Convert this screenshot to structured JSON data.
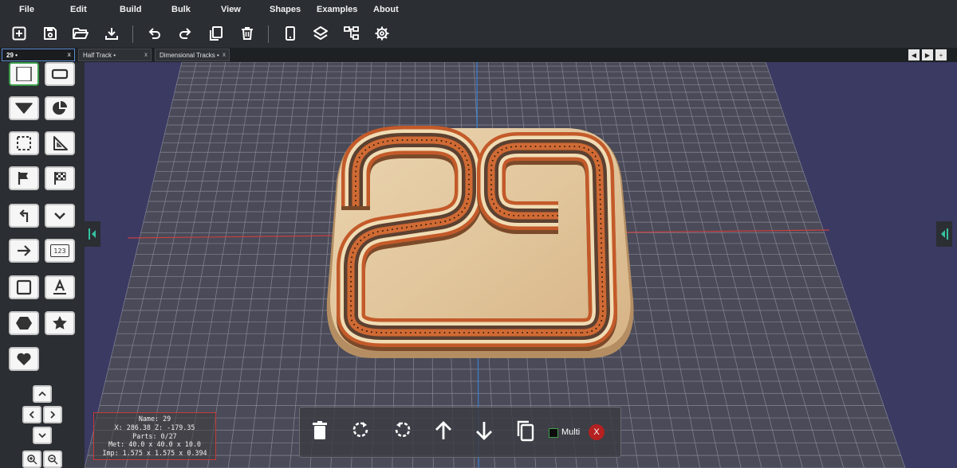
{
  "menu": {
    "items": [
      {
        "label": "File"
      },
      {
        "label": "Edit"
      },
      {
        "label": "Build"
      },
      {
        "label": "Bulk"
      },
      {
        "label": "View"
      },
      {
        "label": "Shapes"
      },
      {
        "label": "Examples"
      },
      {
        "label": "About"
      }
    ]
  },
  "toolbar": {
    "buttons": [
      {
        "icon": "new-file-icon"
      },
      {
        "icon": "save-icon"
      },
      {
        "icon": "open-folder-icon"
      },
      {
        "icon": "download-icon"
      },
      {
        "icon": "undo-icon"
      },
      {
        "icon": "redo-icon"
      },
      {
        "icon": "copy-icon"
      },
      {
        "icon": "trash-icon"
      },
      {
        "icon": "phone-icon"
      },
      {
        "icon": "layers-icon"
      },
      {
        "icon": "hierarchy-icon"
      },
      {
        "icon": "settings-gear-icon"
      }
    ]
  },
  "tabs": [
    {
      "label": "29 •",
      "close": "x",
      "active": true
    },
    {
      "label": "Half Track •",
      "close": "x",
      "active": false
    },
    {
      "label": "Dimensional Tracks •",
      "close": "x",
      "active": false
    }
  ],
  "tab_nav": {
    "prev": "◀",
    "next": "▶",
    "add": "+"
  },
  "palette": {
    "tools": [
      {
        "icon": "square-filled-icon",
        "selected": true
      },
      {
        "icon": "rectangle-outline-icon"
      },
      {
        "icon": "triangle-down-icon"
      },
      {
        "icon": "pie-chart-icon"
      },
      {
        "icon": "selection-frame-icon"
      },
      {
        "icon": "set-square-icon"
      },
      {
        "icon": "flag-icon"
      },
      {
        "icon": "checkered-flag-icon"
      },
      {
        "icon": "return-arrow-icon"
      },
      {
        "icon": "chevron-down-icon"
      },
      {
        "icon": "arrow-right-icon"
      },
      {
        "icon": "number-tag-icon",
        "text": "123"
      },
      {
        "icon": "square-outline-icon"
      },
      {
        "icon": "text-underline-icon"
      },
      {
        "icon": "hexagon-icon"
      },
      {
        "icon": "star-icon"
      },
      {
        "icon": "heart-icon"
      }
    ]
  },
  "info": {
    "name": "Name: 29",
    "coords": "X: 286.38 Z: -179.35",
    "parts": "Parts: 0/27",
    "metric": "Met: 40.0 x 40.0 x 10.0",
    "imperial": "Imp: 1.575 x 1.575 x 0.394"
  },
  "action_bar": {
    "multi_label": "Multi",
    "close_label": "X",
    "buttons": [
      {
        "icon": "trash-icon"
      },
      {
        "icon": "rotate-clockwise-icon"
      },
      {
        "icon": "rotate-counterclockwise-icon"
      },
      {
        "icon": "arrow-up-icon"
      },
      {
        "icon": "arrow-down-icon"
      },
      {
        "icon": "duplicate-icon"
      }
    ]
  },
  "colors": {
    "background": "#3a3a62",
    "grid": "#8a8a9a",
    "axis_x": "#c84040",
    "axis_z": "#3b7fd0",
    "board": "#e0c6a0",
    "track_padauk": "#c35a2a",
    "track_walnut": "#5c4030",
    "track_maple": "#f0dcb4",
    "accent_green": "#3c9b4c"
  }
}
